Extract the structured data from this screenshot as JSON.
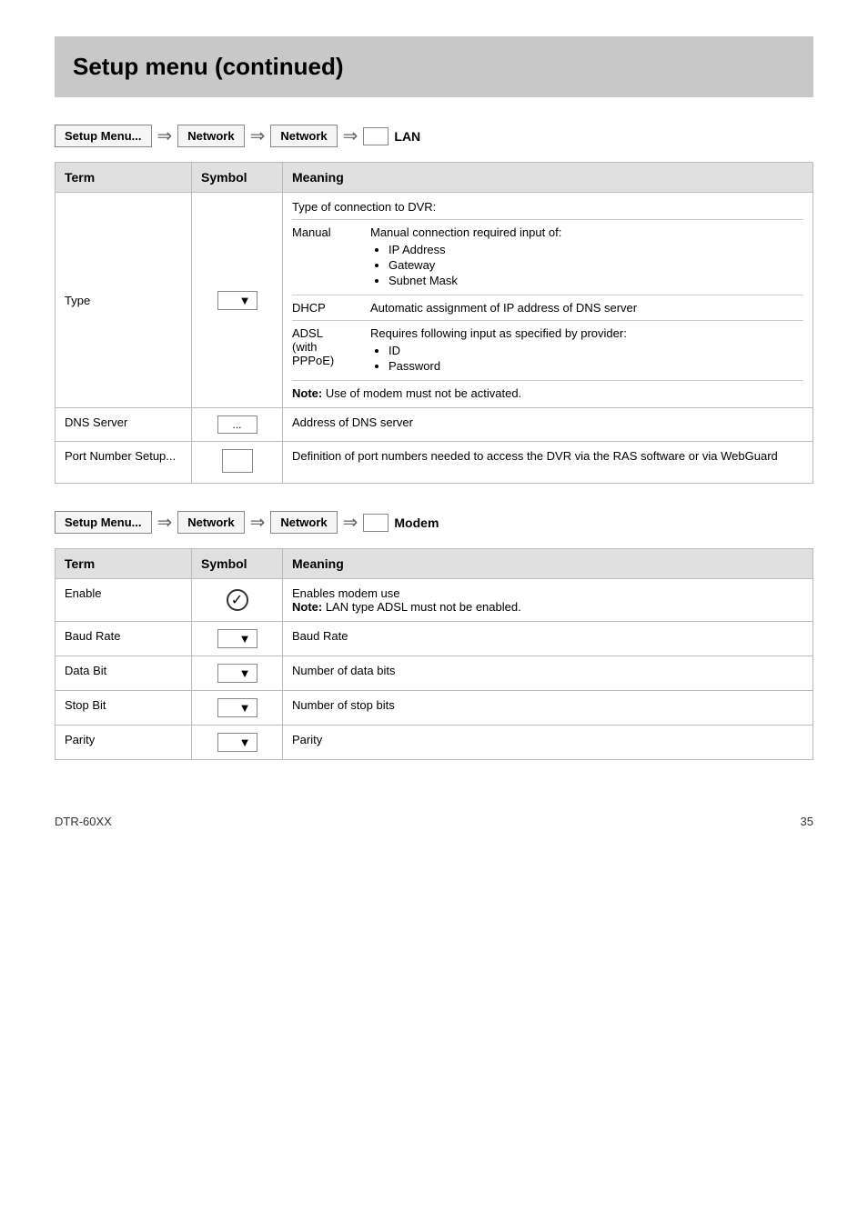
{
  "page": {
    "title": "Setup menu (continued)",
    "footer_model": "DTR-60XX",
    "footer_page": "35"
  },
  "breadcrumb1": {
    "setup_menu": "Setup Menu...",
    "network1": "Network",
    "network2": "Network",
    "final": "LAN"
  },
  "breadcrumb2": {
    "setup_menu": "Setup Menu...",
    "network1": "Network",
    "network2": "Network",
    "final": "Modem"
  },
  "table1": {
    "headers": [
      "Term",
      "Symbol",
      "Meaning"
    ],
    "rows": [
      {
        "term": "Type",
        "symbol": "dropdown",
        "meaning_type": "type_complex"
      },
      {
        "term": "DNS Server",
        "symbol": "ellipsis_btn",
        "meaning": "Address of DNS server"
      },
      {
        "term": "Port Number Setup...",
        "symbol": "rect",
        "meaning": "Definition of port numbers needed to access the DVR via the RAS software or via WebGuard"
      }
    ],
    "type_intro": "Type of connection to DVR:",
    "manual_label": "Manual",
    "manual_desc": "Manual connection required input of:",
    "manual_bullets": [
      "IP Address",
      "Gateway",
      "Subnet Mask"
    ],
    "dhcp_label": "DHCP",
    "dhcp_desc": "Automatic assignment of IP address of DNS server",
    "adsl_label": "ADSL (with PPPoE)",
    "adsl_desc": "Requires following input as specified by provider:",
    "adsl_bullets": [
      "ID",
      "Password"
    ],
    "note": "Note:",
    "note_text": " Use of modem must not be activated."
  },
  "table2": {
    "headers": [
      "Term",
      "Symbol",
      "Meaning"
    ],
    "rows": [
      {
        "term": "Enable",
        "symbol": "checkbox",
        "meaning_main": "Enables modem use",
        "note": "Note:",
        "note_text": " LAN type ADSL must not be enabled."
      },
      {
        "term": "Baud Rate",
        "symbol": "dropdown",
        "meaning": "Baud Rate"
      },
      {
        "term": "Data Bit",
        "symbol": "dropdown",
        "meaning": "Number of data bits"
      },
      {
        "term": "Stop Bit",
        "symbol": "dropdown",
        "meaning": "Number of stop bits"
      },
      {
        "term": "Parity",
        "symbol": "dropdown",
        "meaning": "Parity"
      }
    ]
  }
}
